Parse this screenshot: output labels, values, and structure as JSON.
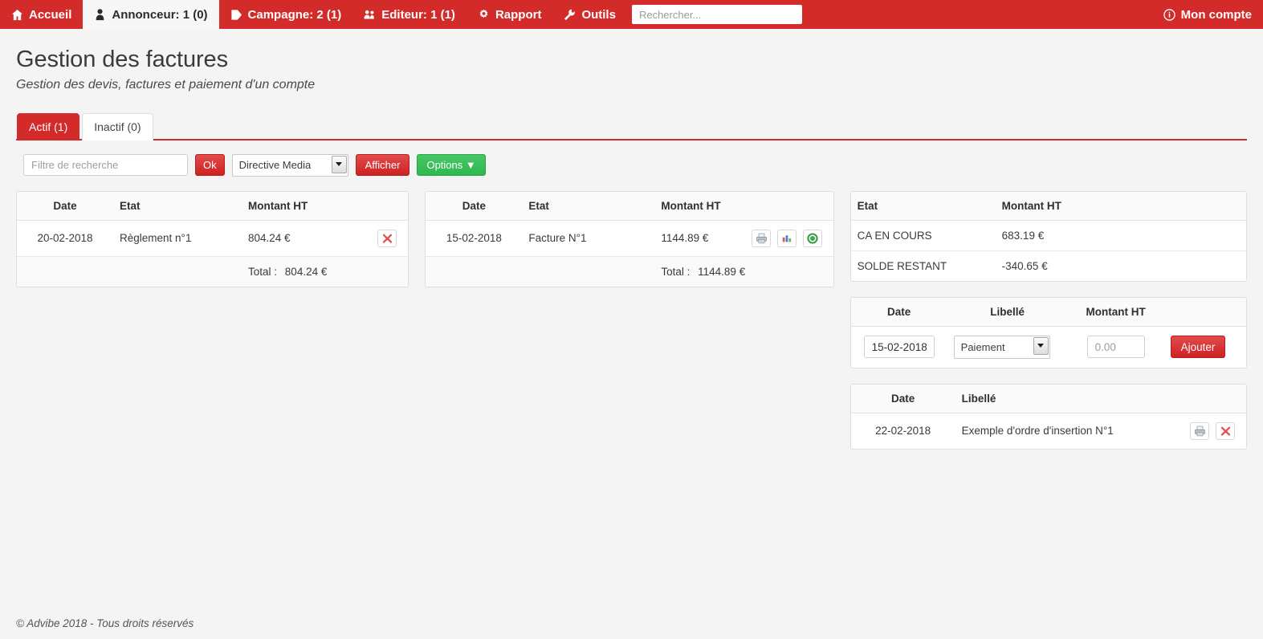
{
  "colors": {
    "brand_red": "#d32a2a",
    "button_red": "#cd2222",
    "button_green": "#2fb84f",
    "money_red": "#c9302c",
    "page_bg": "#f4f4f4"
  },
  "navbar": {
    "items": [
      {
        "label": "Accueil",
        "icon": "home-icon",
        "active": false
      },
      {
        "label": "Annonceur: 1 (0)",
        "icon": "user-icon",
        "active": true
      },
      {
        "label": "Campagne: 2 (1)",
        "icon": "tag-icon",
        "active": false
      },
      {
        "label": "Editeur: 1 (1)",
        "icon": "users-icon",
        "active": false
      },
      {
        "label": "Rapport",
        "icon": "gear-icon",
        "active": false
      },
      {
        "label": "Outils",
        "icon": "wrench-icon",
        "active": false
      }
    ],
    "search_placeholder": "Rechercher...",
    "search_value": "",
    "account": {
      "label": "Mon compte",
      "icon": "info-circle-icon"
    }
  },
  "header": {
    "title": "Gestion des factures",
    "subtitle": "Gestion des devis, factures et paiement d'un compte"
  },
  "tabs": [
    {
      "label": "Actif (1)",
      "active": true
    },
    {
      "label": "Inactif (0)",
      "active": false
    }
  ],
  "filterbar": {
    "search_placeholder": "Filtre de recherche",
    "search_value": "",
    "ok_label": "Ok",
    "select_value": "Directive Media",
    "select_options": [
      "Directive Media"
    ],
    "afficher_label": "Afficher",
    "options_label": "Options ▼"
  },
  "payments_table": {
    "headers": [
      "Date",
      "Etat",
      "Montant HT",
      ""
    ],
    "rows": [
      {
        "date": "20-02-2018",
        "etat": "Règlement n°1",
        "amount": "804.24 €",
        "actions": [
          "delete-icon"
        ]
      }
    ],
    "total_label": "Total :",
    "total_value": "804.24 €"
  },
  "invoices_table": {
    "headers": [
      "Date",
      "Etat",
      "Montant HT",
      ""
    ],
    "rows": [
      {
        "date": "15-02-2018",
        "etat": "Facture N°1",
        "amount": "1144.89 €",
        "actions": [
          "print-icon",
          "chart-icon",
          "validate-icon"
        ]
      }
    ],
    "total_label": "Total :",
    "total_value": "1144.89 €"
  },
  "summary_table": {
    "headers": [
      "Etat",
      "Montant HT"
    ],
    "rows": [
      {
        "label": "CA EN COURS",
        "amount": "683.19 €"
      },
      {
        "label": "SOLDE RESTANT",
        "amount": "-340.65 €"
      }
    ]
  },
  "add_payment": {
    "headers": [
      "Date",
      "Libellé",
      "Montant HT",
      ""
    ],
    "date_value": "15-02-2018",
    "date_placeholder": "",
    "libelle_value": "Paiement",
    "libelle_options": [
      "Paiement"
    ],
    "amount_value": "",
    "amount_placeholder": "0.00",
    "add_label": "Ajouter"
  },
  "orders_table": {
    "headers": [
      "Date",
      "Libellé",
      ""
    ],
    "rows": [
      {
        "date": "22-02-2018",
        "libelle": "Exemple d'ordre d'insertion N°1",
        "actions": [
          "print-icon",
          "delete-icon"
        ]
      }
    ]
  },
  "footer": {
    "text": "© Advibe 2018 - Tous droits réservés"
  }
}
